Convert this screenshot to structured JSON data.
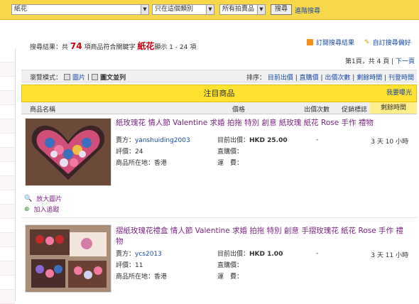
{
  "search": {
    "value": "紙花",
    "category": "只在這個類別",
    "scope": "所有拍賣品",
    "button": "搜尋",
    "advanced": "進階搜尋"
  },
  "results": {
    "prefix": "搜尋結果：共",
    "count": "74",
    "middle": "項商品符合關鍵字",
    "keyword": "紙花",
    "suffix": "顯示 1 - 24 項"
  },
  "subscribe": {
    "rss": "訂閱搜尋結果",
    "save": "自訂搜尋偏好"
  },
  "pager": {
    "text": "第1頁，共 4 頁",
    "next": "下一頁"
  },
  "mode": {
    "label": "瀏覽模式：",
    "pic": "圖片",
    "sep": "|",
    "list": "圖文並列"
  },
  "sort": {
    "label": "排序：",
    "o1": "目前出價",
    "o2": "直購價",
    "o3": "出價次數",
    "o4": "剩餘時間",
    "o5": "刊登時間"
  },
  "featured": {
    "title": "注目商品",
    "hot": "我要曝光"
  },
  "columns": {
    "name": "商品名稱",
    "price": "價格",
    "bids": "出價次數",
    "promo": "促銷標誌",
    "time": "剩餘時間"
  },
  "items": [
    {
      "title": "紙玫瑰花 情人節 Valentine 求婚 拍拖 特別 創意 紙玫瑰 紙花 Rose 手作 禮物",
      "seller_label": "賣方：",
      "seller": "yanshuiding2003",
      "rating_label": "評價：",
      "rating": "24",
      "loc_label": "商品所在地：",
      "loc": "香港",
      "price_label": "目前出價：",
      "price": "HKD 25.00",
      "buy_label": "直購價：",
      "ship_label": "運　費：",
      "bids": "-",
      "remain": "3 天 10 小時"
    },
    {
      "title": "摺紙玫瑰花禮盒 情人節 Valentine 求婚 拍拖 特別 創意 手摺玫瑰花 紙花 Rose 手作 禮物",
      "seller_label": "賣方：",
      "seller": "ycs2013",
      "rating_label": "評價：",
      "rating": "11",
      "loc_label": "商品所在地：",
      "loc": "香港",
      "price_label": "目前出價：",
      "price": "HKD 1.00",
      "buy_label": "直購價：",
      "ship_label": "運　費：",
      "bids": "-",
      "remain": "3 天 11 小時"
    }
  ],
  "tools": {
    "zoom": "放大圖片",
    "watch": "加入追蹤"
  }
}
